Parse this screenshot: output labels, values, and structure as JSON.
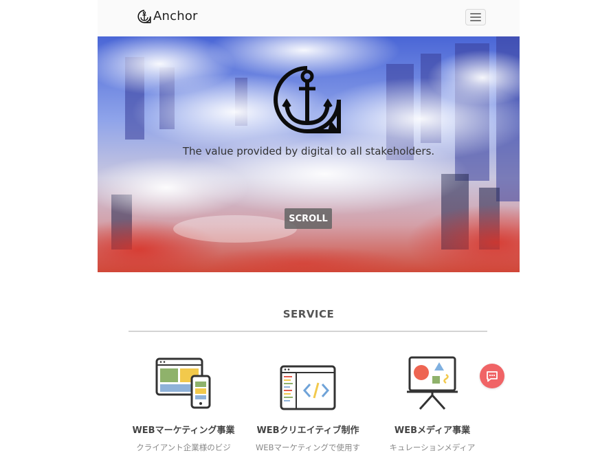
{
  "header": {
    "brand": "Anchor",
    "logo_icon": "anchor-icon",
    "menu_icon": "hamburger-icon"
  },
  "hero": {
    "emblem_icon": "anchor-emblem-icon",
    "tagline": "The value provided by digital to all stakeholders.",
    "scroll_label": "SCROLL"
  },
  "service": {
    "title": "SERVICE",
    "items": [
      {
        "icon": "responsive-devices-icon",
        "name": "WEBマーケティング事業",
        "desc": "クライアント企業様のビジ"
      },
      {
        "icon": "code-editor-icon",
        "name": "WEBクリエイティブ制作",
        "desc": "WEBマーケティングで使用す"
      },
      {
        "icon": "presentation-board-icon",
        "name": "WEBメディア事業",
        "desc": "キュレーションメディア"
      }
    ]
  },
  "chat": {
    "icon": "chat-bubble-icon"
  },
  "colors": {
    "accent_chat": "#f06466",
    "scroll_button": "#646464",
    "divider": "#d4d4d4"
  }
}
